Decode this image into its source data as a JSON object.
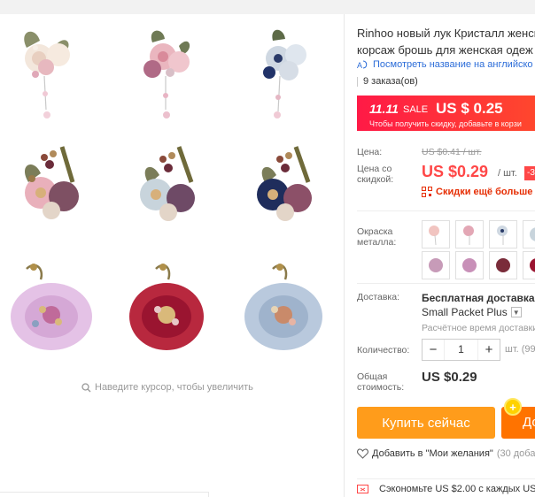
{
  "gallery": {
    "zoom_hint": "Наведите курсор, чтобы увеличить"
  },
  "product": {
    "title_line1": "Rinhoo новый лук Кристалл женск",
    "title_line2": "корсаж брошь для женская одеж",
    "translate_link": "Посмотреть название на английско",
    "orders": "9 заказа(ов)"
  },
  "sale": {
    "logo": "11.11",
    "word": "SALE",
    "price": "US $ 0.25",
    "subtitle": "Чтобы получить скидку, добавьте в корзи"
  },
  "price": {
    "label": "Цена:",
    "old_value": "US $0.41 / шт.",
    "discount_label_line1": "Цена со",
    "discount_label_line2": "скидкой:",
    "current": "US $0.29",
    "per_unit": "/ шт.",
    "badge": "-3",
    "coupon_text": "Скидки ещё больше в"
  },
  "color": {
    "label_line1": "Окраска",
    "label_line2": "металла:",
    "swatch_palette": [
      "#f1c4c0",
      "#cfd8e2",
      "#1f2d5c",
      "#c79bb8",
      "#7a2c3a",
      "#9a1430"
    ]
  },
  "shipping": {
    "label": "Доставка:",
    "main": "Бесплатная доставка в Р",
    "method": "Small Packet Plus",
    "time": "Расчётное время доставки"
  },
  "quantity": {
    "label": "Количество:",
    "minus": "−",
    "value": "1",
    "plus": "+",
    "available": "шт. (99"
  },
  "total": {
    "label_line1": "Общая",
    "label_line2": "стоимость:",
    "value": "US $0.29"
  },
  "actions": {
    "buy_now": "Купить сейчас",
    "add_to_cart": "До",
    "coin": "+",
    "wishlist": "Добавить в \"Мои желания\"",
    "wishlist_count": "(30 добав"
  },
  "promo": {
    "text": "Сэкономьте US $2.00 с каждых US"
  },
  "colors": {
    "accent_red": "#ff4747",
    "buy_orange": "#ff9c1b",
    "cart_orange": "#ff7300",
    "link_blue": "#2b6cd8"
  }
}
